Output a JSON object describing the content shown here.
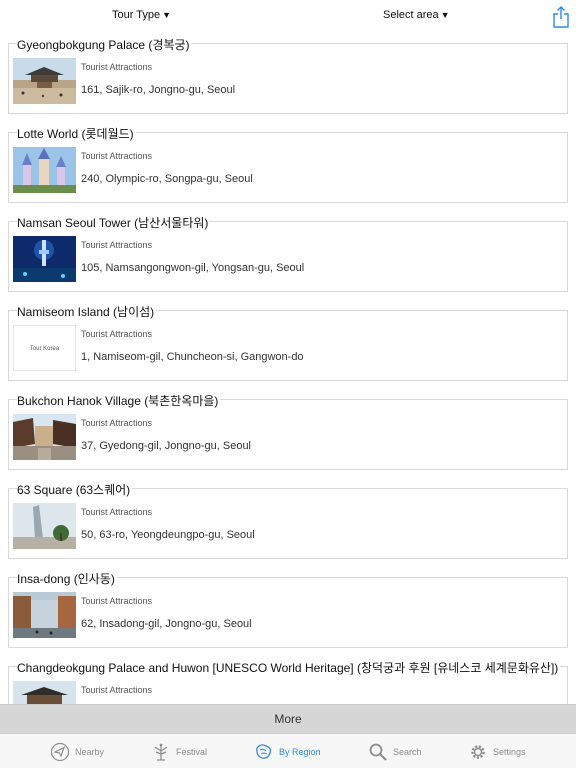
{
  "filters": {
    "tour_type_label": "Tour Type",
    "select_area_label": "Select area",
    "dropdown_glyph": "▼"
  },
  "share_icon": "share-icon",
  "places": [
    {
      "title": "Gyeongbokgung Palace (경복궁)",
      "category": "Tourist Attractions",
      "address": "161, Sajik-ro, Jongno-gu, Seoul",
      "thumb": "palace"
    },
    {
      "title": "Lotte World (롯데월드)",
      "category": "Tourist Attractions",
      "address": "240, Olympic-ro, Songpa-gu, Seoul",
      "thumb": "castle"
    },
    {
      "title": "Namsan Seoul Tower (남산서울타워)",
      "category": "Tourist Attractions",
      "address": "105, Namsangongwon-gil, Yongsan-gu, Seoul",
      "thumb": "tower"
    },
    {
      "title": "Namiseom Island (남이섬)",
      "category": "Tourist Attractions",
      "address": "1, Namiseom-gil, Chuncheon-si, Gangwon-do",
      "thumb": "placeholder",
      "placeholder_text": "Tour Korea"
    },
    {
      "title": "Bukchon Hanok Village (북촌한옥마을)",
      "category": "Tourist Attractions",
      "address": "37, Gyedong-gil, Jongno-gu, Seoul",
      "thumb": "hanok"
    },
    {
      "title": "63 Square (63스퀘어)",
      "category": "Tourist Attractions",
      "address": "50, 63-ro, Yeongdeungpo-gu, Seoul",
      "thumb": "skyscraper"
    },
    {
      "title": "Insa-dong (인사동)",
      "category": "Tourist Attractions",
      "address": "62, Insadong-gil, Jongno-gu, Seoul",
      "thumb": "street"
    },
    {
      "title": "Changdeokgung Palace and Huwon [UNESCO World Heritage] (창덕궁과 후원 [유네스코 세계문화유산])",
      "category": "Tourist Attractions",
      "address": "",
      "thumb": "palace2"
    }
  ],
  "more_label": "More",
  "tabs": [
    {
      "label": "Nearby",
      "icon": "location-arrow-icon",
      "active": false
    },
    {
      "label": "Festival",
      "icon": "festival-icon",
      "active": false
    },
    {
      "label": "By Region",
      "icon": "map-icon",
      "active": true
    },
    {
      "label": "Search",
      "icon": "search-icon",
      "active": false
    },
    {
      "label": "Settings",
      "icon": "gear-icon",
      "active": false
    }
  ],
  "colors": {
    "accent": "#2f8ae6",
    "tab_inactive": "#8e8e8e",
    "more_bar": "#d6d6d6",
    "card_border": "#d8d8d8"
  }
}
